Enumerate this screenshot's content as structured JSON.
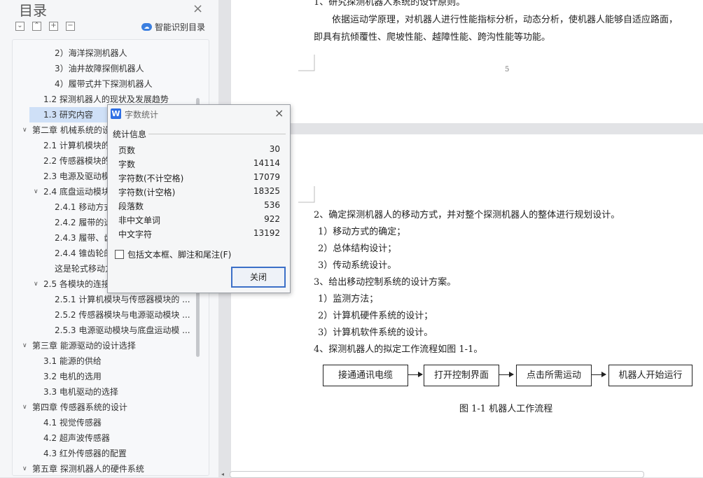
{
  "toc": {
    "title": "目录",
    "smart_label": "智能识别目录",
    "items": [
      "2）海洋探测机器人",
      "3）油井故障探侧机器人",
      "4）履带式井下探测机器人",
      "1.2  探测机器人的现状及发展趋势",
      "1.3  研究内容",
      "第二章  机械系统的设",
      "2.1 计算机模块的",
      "2.2 传感器模块的",
      "2.3 电源及驱动模",
      "2.4 底盘运动模块",
      "2.4.1 移动方式",
      "2.4.2  履带的选",
      "2.4.3  履带、齿",
      "2.4.4 锥齿轮的",
      "这是轮式移动方",
      "2.5  各模块的连接",
      "2.5.1  计算机模块与传感器模块的 ...",
      "2.5.2  传感器模块与电源驱动模块 ...",
      "2.5.3 电源驱动模块与底盘运动模 ...",
      "第三章    能源驱动的设计选择",
      "3.1 能源的供给",
      "3.2 电机的选用",
      "3.3 电机驱动的选择",
      "第四章    传感器系统的设计",
      "4.1 视觉传感器",
      "4.2 超声波传感器",
      "4.3 红外传感器的配置",
      "第五章  探测机器人的硬件系统"
    ]
  },
  "document": {
    "top_line1": "1、研究探测机器人系统的设计原则。",
    "top_line2": "依据运动学原理，对机器人进行性能指标分析，动态分析，使机器人能够自适应路面，",
    "top_line3": "即具有抗倾覆性、爬坡性能、越障性能、跨沟性能等功能。",
    "page_number": "5",
    "lines": [
      "2、确定探测机器人的移动方式，并对整个探测机器人的整体进行规划设计。",
      "1）移动方式的确定；",
      "2）总体结构设计；",
      "3）传动系统设计。",
      "3、给出移动控制系统的设计方案。",
      "1）监测方法；",
      "2）计算机硬件系统的设计；",
      "3）计算机软件系统的设计。",
      "4、探测机器人的拟定工作流程如图 1-1。"
    ],
    "flow": [
      "接通通讯电缆",
      "打开控制界面",
      "点击所需运动",
      "机器人开始运行"
    ],
    "figure_caption": "图 1-1 机器人工作流程"
  },
  "dialog": {
    "title": "字数统计",
    "section": "统计信息",
    "stats": [
      {
        "label": "页数",
        "value": "30"
      },
      {
        "label": "字数",
        "value": "14114"
      },
      {
        "label": "字符数(不计空格)",
        "value": "17079"
      },
      {
        "label": "字符数(计空格)",
        "value": "18325"
      },
      {
        "label": "段落数",
        "value": "536"
      },
      {
        "label": "非中文单词",
        "value": "922"
      },
      {
        "label": "中文字符",
        "value": "13192"
      }
    ],
    "checkbox_label": "包括文本框、脚注和尾注(F)",
    "close_button": "关闭"
  },
  "colors": {
    "selection": "#cfe0f7",
    "accent": "#3b6fc7",
    "page_bg": "#ffffff",
    "workspace_bg": "#e2e3e6"
  }
}
